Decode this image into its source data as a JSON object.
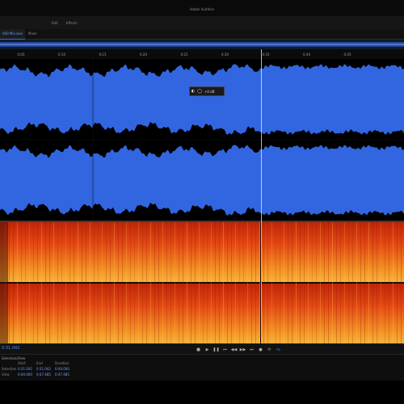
{
  "app": {
    "title": "Adobe Audition"
  },
  "menu": {
    "items": [
      "Edit",
      "Effects"
    ]
  },
  "tabs": [
    {
      "label": "000 Mix.wav",
      "active": true
    },
    {
      "label": "Mixer",
      "active": false
    }
  ],
  "ruler": {
    "ticks": [
      "0:05",
      "0:10",
      "0:15",
      "0:20",
      "0:25",
      "0:30",
      "0:35",
      "0:40",
      "0:45"
    ]
  },
  "hud": {
    "value": "+0 dB"
  },
  "transport": {
    "timecode": "0:31.042",
    "buttons": [
      "stop-icon",
      "play-icon",
      "pause-icon",
      "rewind-start-icon",
      "rewind-icon",
      "fast-forward-icon",
      "forward-end-icon",
      "record-icon",
      "loop-icon",
      "skip-icon"
    ]
  },
  "selection": {
    "title": "Selection/View",
    "headers": [
      "Start",
      "End",
      "Duration"
    ],
    "rows": [
      {
        "label": "Selection",
        "values": [
          "0:31.042",
          "0:31.042",
          "0:00.000"
        ]
      },
      {
        "label": "View",
        "values": [
          "0:00.000",
          "0:47.485",
          "0:47.485"
        ]
      }
    ]
  },
  "colors": {
    "waveform_fill": "#3266e0",
    "spectral_hot": "#f6b33a",
    "spectral_mid": "#e24613",
    "accent": "#2d6be0"
  }
}
